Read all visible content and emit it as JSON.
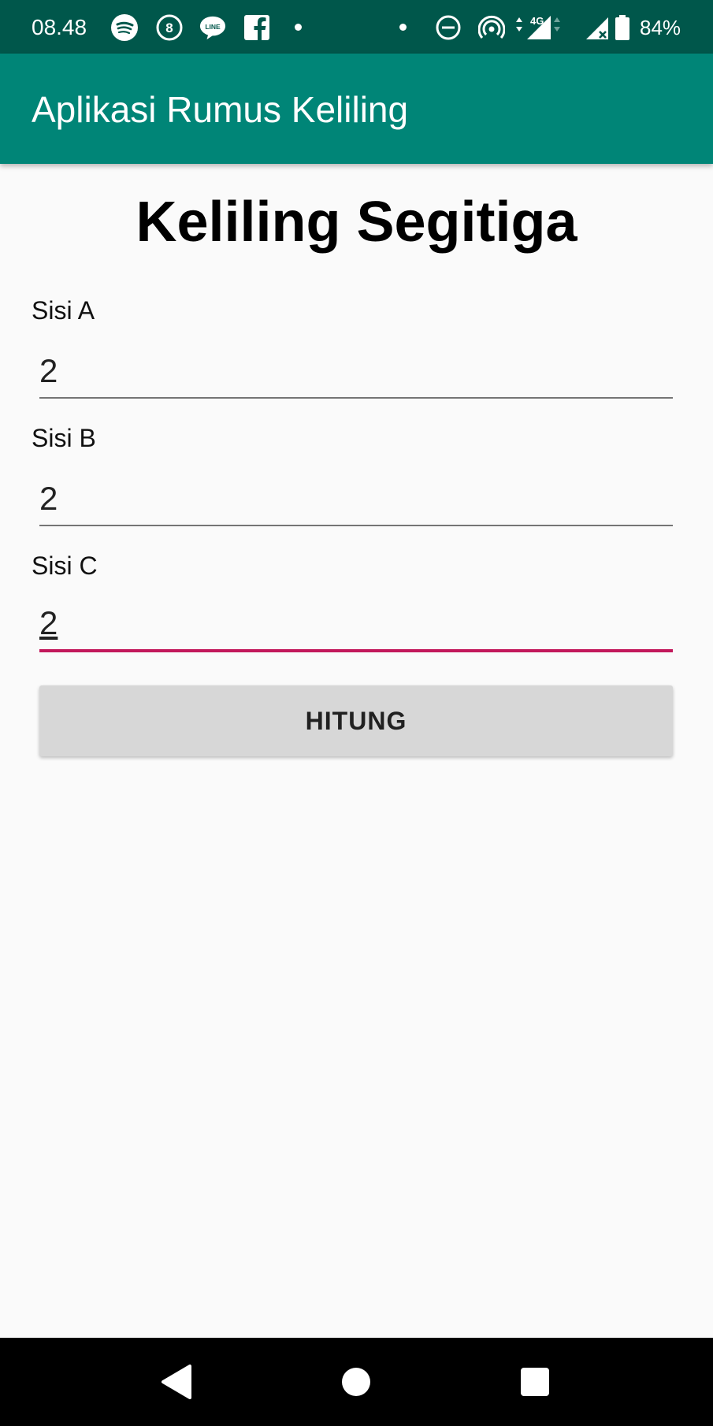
{
  "status_bar": {
    "time": "08.48",
    "battery_percent": "84%",
    "icons": [
      "spotify-icon",
      "notification-8-icon",
      "line-icon",
      "facebook-icon",
      "dot-icon",
      "dot-icon",
      "do-not-disturb-icon",
      "hotspot-icon",
      "signal-4g-icon",
      "signal-no-sim-icon",
      "battery-icon"
    ],
    "network_label": "4G"
  },
  "app_bar": {
    "title": "Aplikasi Rumus Keliling"
  },
  "main": {
    "heading": "Keliling Segitiga",
    "fields": [
      {
        "label": "Sisi A",
        "value": "2"
      },
      {
        "label": "Sisi B",
        "value": "2"
      },
      {
        "label": "Sisi C",
        "value": "2"
      }
    ],
    "button_label": "HITUNG"
  },
  "nav_bar": {
    "icons": [
      "back-icon",
      "home-icon",
      "recents-icon"
    ]
  },
  "colors": {
    "status_bar": "#00574b",
    "app_bar": "#008577",
    "accent": "#c2185b",
    "background": "#fafafa",
    "button": "#d7d7d7"
  }
}
